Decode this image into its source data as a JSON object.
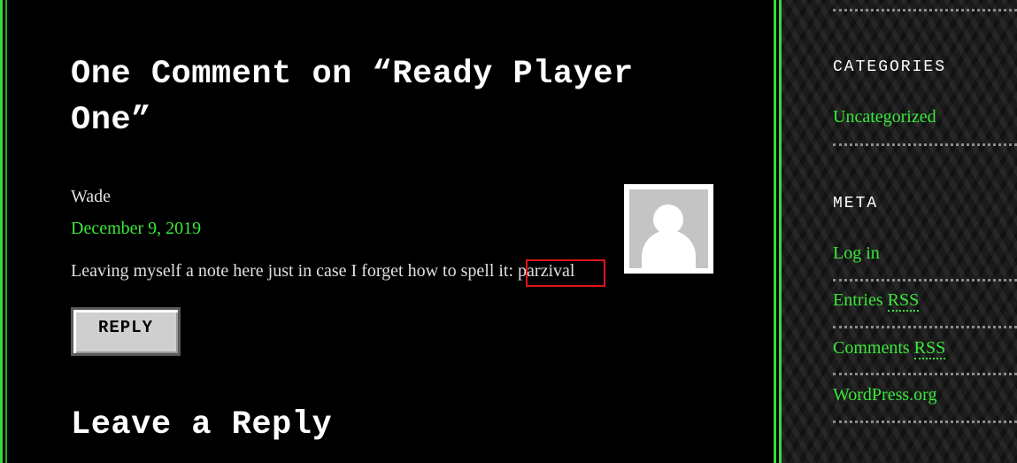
{
  "comments": {
    "title": "One Comment on “Ready Player One”",
    "author": "Wade",
    "date": "December 9, 2019",
    "text": "Leaving myself a note here just in case I forget how to spell it: parzival",
    "reply_label": "REPLY",
    "avatar_icon": "default-user-avatar-icon"
  },
  "reply_form": {
    "title": "Leave a Reply"
  },
  "sidebar": {
    "categories_title": "CATEGORIES",
    "categories": [
      "Uncategorized"
    ],
    "meta_title": "META",
    "meta_links": {
      "login": "Log in",
      "entries_prefix": "Entries ",
      "entries_abbr": "RSS",
      "comments_prefix": "Comments ",
      "comments_abbr": "RSS",
      "wordpress": "WordPress.org"
    }
  },
  "colors": {
    "background": "#000000",
    "accent_green": "#3ae83a",
    "highlight_red": "#e0161a",
    "text": "#e0e0e0"
  }
}
